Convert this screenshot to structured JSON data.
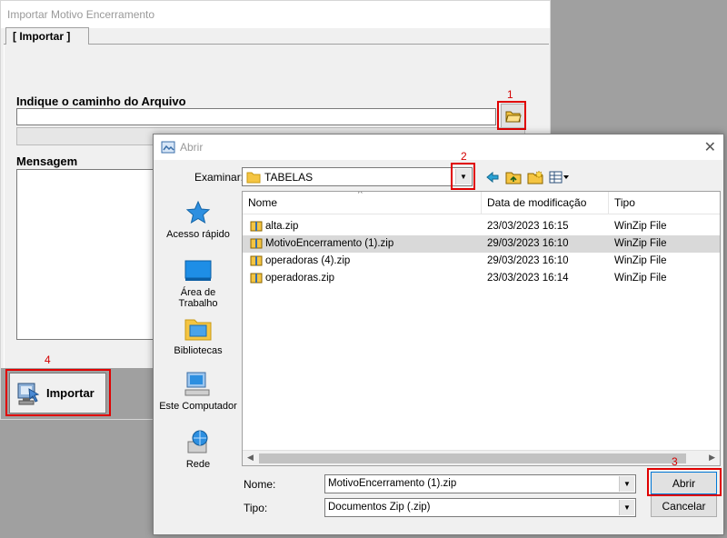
{
  "main_window": {
    "title": "Importar Motivo Encerramento",
    "tab_label": "[ Importar ]",
    "path_label": "Indique o caminho do Arquivo",
    "path_value": "",
    "message_label": "Mensagem",
    "import_button": "Importar"
  },
  "callouts": [
    "1",
    "2",
    "3",
    "4"
  ],
  "dialog": {
    "title": "Abrir",
    "look_in_label": "Examinar:",
    "look_in_value": "TABELAS",
    "places": [
      "Acesso rápido",
      "Área de\nTrabalho",
      "Bibliotecas",
      "Este Computador",
      "Rede"
    ],
    "columns": [
      "Nome",
      "Data de modificação",
      "Tipo"
    ],
    "files": [
      {
        "name": "alta.zip",
        "date": "23/03/2023 16:15",
        "type": "WinZip File",
        "selected": false
      },
      {
        "name": "MotivoEncerramento (1).zip",
        "date": "29/03/2023 16:10",
        "type": "WinZip File",
        "selected": true
      },
      {
        "name": "operadoras (4).zip",
        "date": "29/03/2023 16:10",
        "type": "WinZip File",
        "selected": false
      },
      {
        "name": "operadoras.zip",
        "date": "23/03/2023 16:14",
        "type": "WinZip File",
        "selected": false
      }
    ],
    "filename_label": "Nome:",
    "filename_value": "MotivoEncerramento (1).zip",
    "filetype_label": "Tipo:",
    "filetype_value": "Documentos Zip (.zip)",
    "open_button": "Abrir",
    "cancel_button": "Cancelar"
  },
  "colors": {
    "callout_red": "#e00000",
    "selection": "#d9d9d9",
    "folder": "#f5c542"
  }
}
